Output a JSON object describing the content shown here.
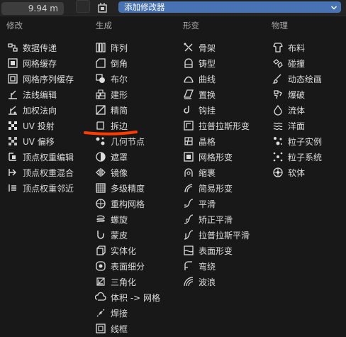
{
  "header": {
    "value_field": "9.94 m",
    "add_modifier": "添加修改器"
  },
  "columns": [
    {
      "title": "修改",
      "items": [
        {
          "label": "数据传递",
          "icon": "data-transfer-icon"
        },
        {
          "label": "网格缓存",
          "icon": "mesh-cache-icon"
        },
        {
          "label": "网格序列缓存",
          "icon": "mesh-sequence-cache-icon"
        },
        {
          "label": "法线编辑",
          "icon": "normal-edit-icon"
        },
        {
          "label": "加权法向",
          "icon": "weighted-normal-icon"
        },
        {
          "label": "UV 投射",
          "icon": "uv-project-icon"
        },
        {
          "label": "UV 偏移",
          "icon": "uv-warp-icon"
        },
        {
          "label": "顶点权重编辑",
          "icon": "vertex-weight-edit-icon"
        },
        {
          "label": "顶点权重混合",
          "icon": "vertex-weight-mix-icon"
        },
        {
          "label": "顶点权重邻近",
          "icon": "vertex-weight-proximity-icon"
        }
      ]
    },
    {
      "title": "生成",
      "items": [
        {
          "label": "阵列",
          "icon": "array-icon"
        },
        {
          "label": "倒角",
          "icon": "bevel-icon"
        },
        {
          "label": "布尔",
          "icon": "boolean-icon"
        },
        {
          "label": "建形",
          "icon": "build-icon"
        },
        {
          "label": "精简",
          "icon": "decimate-icon"
        },
        {
          "label": "拆边",
          "icon": "edge-split-icon"
        },
        {
          "label": "几何节点",
          "icon": "geometry-nodes-icon"
        },
        {
          "label": "遮罩",
          "icon": "mask-icon"
        },
        {
          "label": "镜像",
          "icon": "mirror-icon"
        },
        {
          "label": "多级精度",
          "icon": "multires-icon"
        },
        {
          "label": "重构网格",
          "icon": "remesh-icon"
        },
        {
          "label": "螺旋",
          "icon": "screw-icon"
        },
        {
          "label": "蒙皮",
          "icon": "skin-icon"
        },
        {
          "label": "实体化",
          "icon": "solidify-icon"
        },
        {
          "label": "表面细分",
          "icon": "subdivision-surface-icon"
        },
        {
          "label": "三角化",
          "icon": "triangulate-icon"
        },
        {
          "label": "体积 -> 网格",
          "icon": "volume-to-mesh-icon"
        },
        {
          "label": "焊接",
          "icon": "weld-icon"
        },
        {
          "label": "线框",
          "icon": "wireframe-icon"
        }
      ]
    },
    {
      "title": "形变",
      "items": [
        {
          "label": "骨架",
          "icon": "armature-icon"
        },
        {
          "label": "铸型",
          "icon": "cast-icon"
        },
        {
          "label": "曲线",
          "icon": "curve-icon"
        },
        {
          "label": "置换",
          "icon": "displace-icon"
        },
        {
          "label": "钩挂",
          "icon": "hook-icon"
        },
        {
          "label": "拉普拉斯形变",
          "icon": "laplacian-deform-icon"
        },
        {
          "label": "晶格",
          "icon": "lattice-icon"
        },
        {
          "label": "网格形变",
          "icon": "mesh-deform-icon"
        },
        {
          "label": "缩裹",
          "icon": "shrinkwrap-icon"
        },
        {
          "label": "简易形变",
          "icon": "simple-deform-icon"
        },
        {
          "label": "平滑",
          "icon": "smooth-icon"
        },
        {
          "label": "矫正平滑",
          "icon": "corrective-smooth-icon"
        },
        {
          "label": "拉普拉斯平滑",
          "icon": "laplacian-smooth-icon"
        },
        {
          "label": "表面形变",
          "icon": "surface-deform-icon"
        },
        {
          "label": "弯绕",
          "icon": "warp-icon"
        },
        {
          "label": "波浪",
          "icon": "wave-icon"
        }
      ]
    },
    {
      "title": "物理",
      "items": [
        {
          "label": "布料",
          "icon": "cloth-icon"
        },
        {
          "label": "碰撞",
          "icon": "collision-icon"
        },
        {
          "label": "动态绘画",
          "icon": "dynamic-paint-icon"
        },
        {
          "label": "爆破",
          "icon": "explode-icon"
        },
        {
          "label": "流体",
          "icon": "fluid-icon"
        },
        {
          "label": "洋面",
          "icon": "ocean-icon"
        },
        {
          "label": "粒子实例",
          "icon": "particle-instance-icon"
        },
        {
          "label": "粒子系统",
          "icon": "particle-system-icon"
        },
        {
          "label": "软体",
          "icon": "soft-body-icon"
        }
      ]
    }
  ]
}
